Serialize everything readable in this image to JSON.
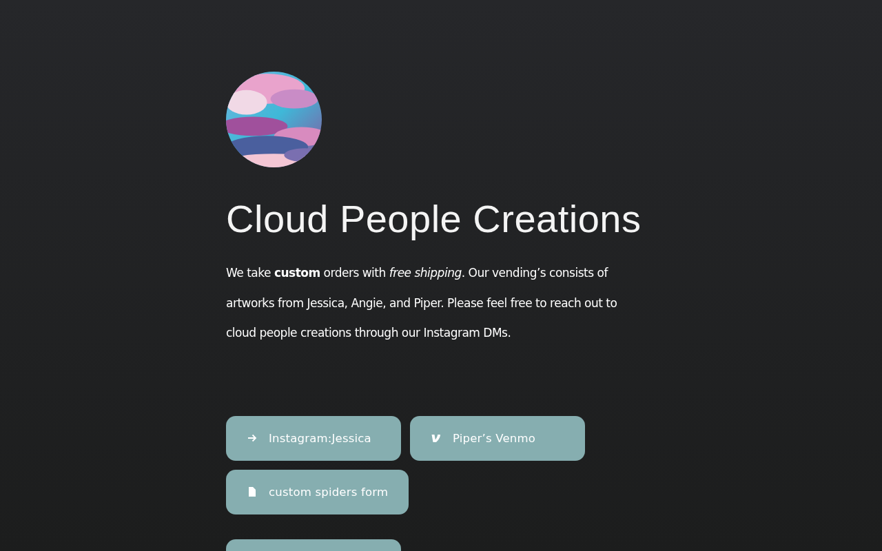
{
  "avatar": {
    "kind": "picture"
  },
  "title": "Cloud People Creations",
  "description": "We take **custom** orders with *free shipping*. Our vending’s consists of artworks from Jessica, Angie, and Piper. Please feel free to reach out to cloud people creations through our Instagram DMs.",
  "link_groups": [
    [
      {
        "kind": "arrow",
        "label": "Instagram:Jessica"
      },
      {
        "kind": "venmo",
        "label": "Piper’s Venmo"
      },
      {
        "kind": "document",
        "label": "custom spiders form"
      }
    ],
    [
      {
        "kind": "blank"
      }
    ]
  ]
}
